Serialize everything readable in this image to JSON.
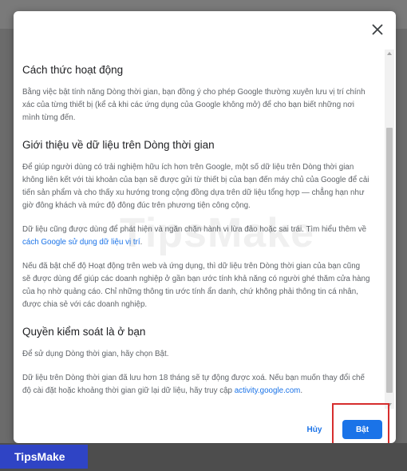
{
  "dialog": {
    "close_icon": "close-icon",
    "sections": [
      {
        "title": "Cách thức hoạt động",
        "paragraphs": [
          "Bằng việc bật tính năng Dòng thời gian, bạn đồng ý cho phép Google thường xuyên lưu vị trí chính xác của từng thiết bị (kể cả khi các ứng dụng của Google không mở) để cho bạn biết những nơi mình từng đến."
        ]
      },
      {
        "title": "Giới thiệu về dữ liệu trên Dòng thời gian",
        "paragraphs": [
          "Để giúp người dùng có trải nghiệm hữu ích hơn trên Google, một số dữ liệu trên Dòng thời gian không liên kết với tài khoản của bạn sẽ được gửi từ thiết bị của bạn đến máy chủ của Google để cải tiến sản phẩm và cho thấy xu hướng trong cộng đồng dựa trên dữ liệu tổng hợp — chẳng hạn như giờ đông khách và mức độ đông đúc trên phương tiện công cộng."
        ],
        "para2_text": "Dữ liệu cũng được dùng để phát hiện và ngăn chặn hành vi lừa đảo hoặc sai trái. Tìm hiểu thêm về ",
        "para2_link": "cách Google sử dụng dữ liệu vị trí",
        "para2_end": ".",
        "para3": "Nếu đã bật chế độ Hoạt động trên web và ứng dụng, thì dữ liệu trên Dòng thời gian của bạn cũng sẽ được dùng để giúp các doanh nghiệp ở gần bạn ước tính khả năng có người ghé thăm cửa hàng của họ nhờ quảng cáo. Chỉ những thông tin ước tính ẩn danh, chứ không phải thông tin cá nhân, được chia sẻ với các doanh nghiệp."
      },
      {
        "title": "Quyền kiểm soát là ở bạn",
        "para1": "Để sử dụng Dòng thời gian, hãy chọn Bật.",
        "para2_text": "Dữ liệu trên Dòng thời gian đã lưu hơn 18 tháng sẽ tự động được xoá. Nếu bạn muốn thay đổi chế độ cài đặt hoặc khoảng thời gian giữ lại dữ liệu, hãy truy cập ",
        "para2_link": "activity.google.com",
        "para2_end": "."
      }
    ],
    "cancel_label": "Hủy",
    "confirm_label": "Bật"
  },
  "watermark_text": "TipsMake",
  "brand_label": "TipsMake",
  "colors": {
    "accent": "#1a73e8",
    "highlight": "#d62d2d",
    "brand": "#2f44c5"
  }
}
